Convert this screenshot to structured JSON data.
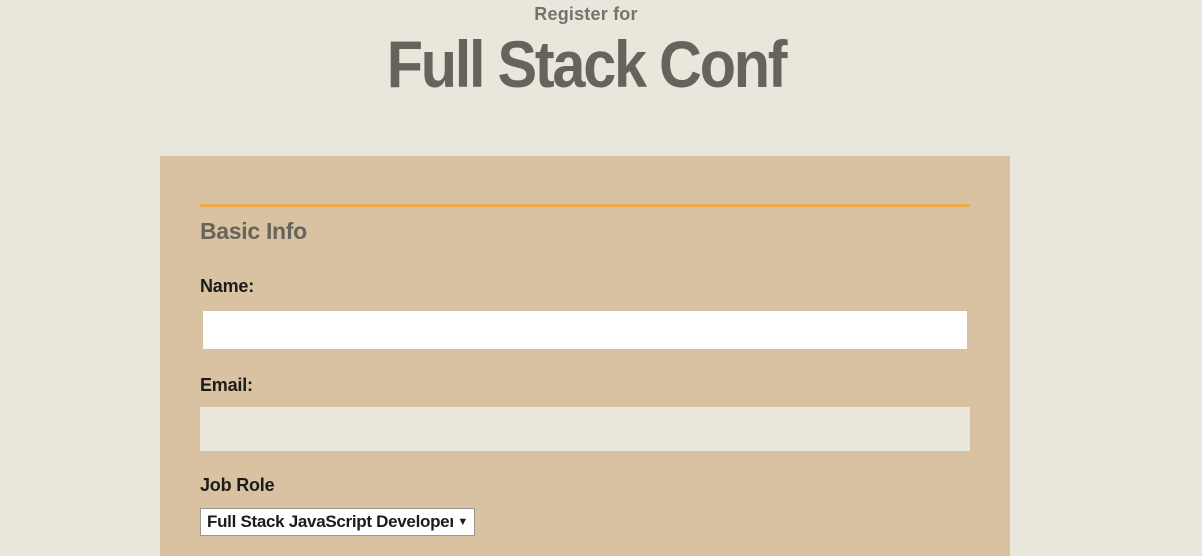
{
  "header": {
    "kicker": "Register for",
    "title": "Full Stack Conf"
  },
  "form": {
    "section_title": "Basic Info",
    "name": {
      "label": "Name:",
      "value": "",
      "placeholder": ""
    },
    "email": {
      "label": "Email:",
      "value": "",
      "placeholder": ""
    },
    "job_role": {
      "label": "Job Role",
      "selected": "Full Stack JavaScript Developer",
      "icon": "chevron-down-icon"
    }
  },
  "colors": {
    "page_background": "#e9e6dc",
    "card_background": "#d8c2a2",
    "accent_rule": "#f1a94d",
    "title_text": "#66625c"
  }
}
